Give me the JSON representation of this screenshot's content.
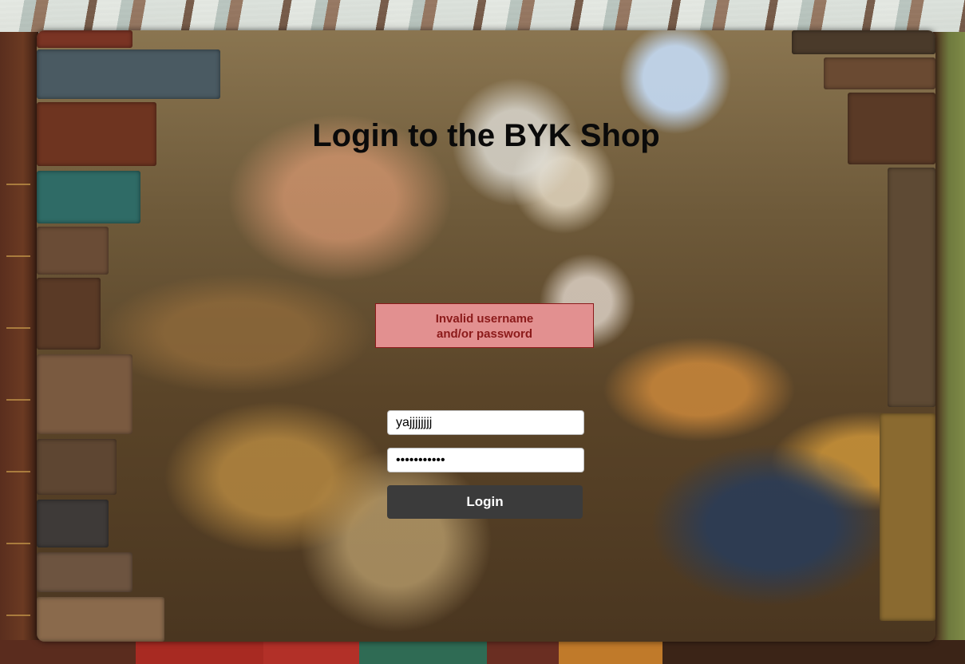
{
  "page": {
    "title": "Login to the BYK Shop"
  },
  "error": {
    "line1": "Invalid username",
    "line2": "and/or password",
    "color": "#8b1a1a",
    "background": "#e29090"
  },
  "form": {
    "username_value": "yajjjjjjjj",
    "password_value": "hhhhhhhhhhh",
    "login_label": "Login"
  },
  "colors": {
    "button_bg": "#3b3b3b",
    "title": "#0a0a0a"
  }
}
